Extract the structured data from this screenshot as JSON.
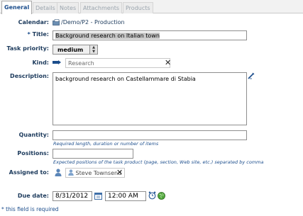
{
  "tabs": [
    {
      "label": "General",
      "active": true
    },
    {
      "label": "Details",
      "active": false
    },
    {
      "label": "Notes",
      "active": false
    },
    {
      "label": "Attachments",
      "active": false
    },
    {
      "label": "Products",
      "active": false
    }
  ],
  "calendar": {
    "label": "Calendar:",
    "value": "/Demo/P2 - Production"
  },
  "title": {
    "required_mark": "*",
    "label": "Title:",
    "value": "Background research on Italian town"
  },
  "priority": {
    "label": "Task priority:",
    "value": "medium"
  },
  "kind": {
    "label": "Kind:",
    "value": "Research"
  },
  "description": {
    "label": "Description:",
    "value": "background research on Castellammare di Stabia"
  },
  "quantity": {
    "label": "Quantity:",
    "value": "",
    "hint": "Required length, duration or number of items"
  },
  "positions": {
    "label": "Positions:",
    "value": "",
    "hint": "Expected positions of the task product (page, section, Web site, etc.) separated by comma"
  },
  "assigned": {
    "label": "Assigned to:",
    "value": "Steve Townsend"
  },
  "due": {
    "label": "Due date:",
    "date": "8/31/2012",
    "time": "12:00 AM"
  },
  "footer": {
    "note": "* this field is required"
  },
  "colors": {
    "accent": "#1b4d8c",
    "label": "#1c3a5c",
    "selection": "#c6c6c6"
  }
}
